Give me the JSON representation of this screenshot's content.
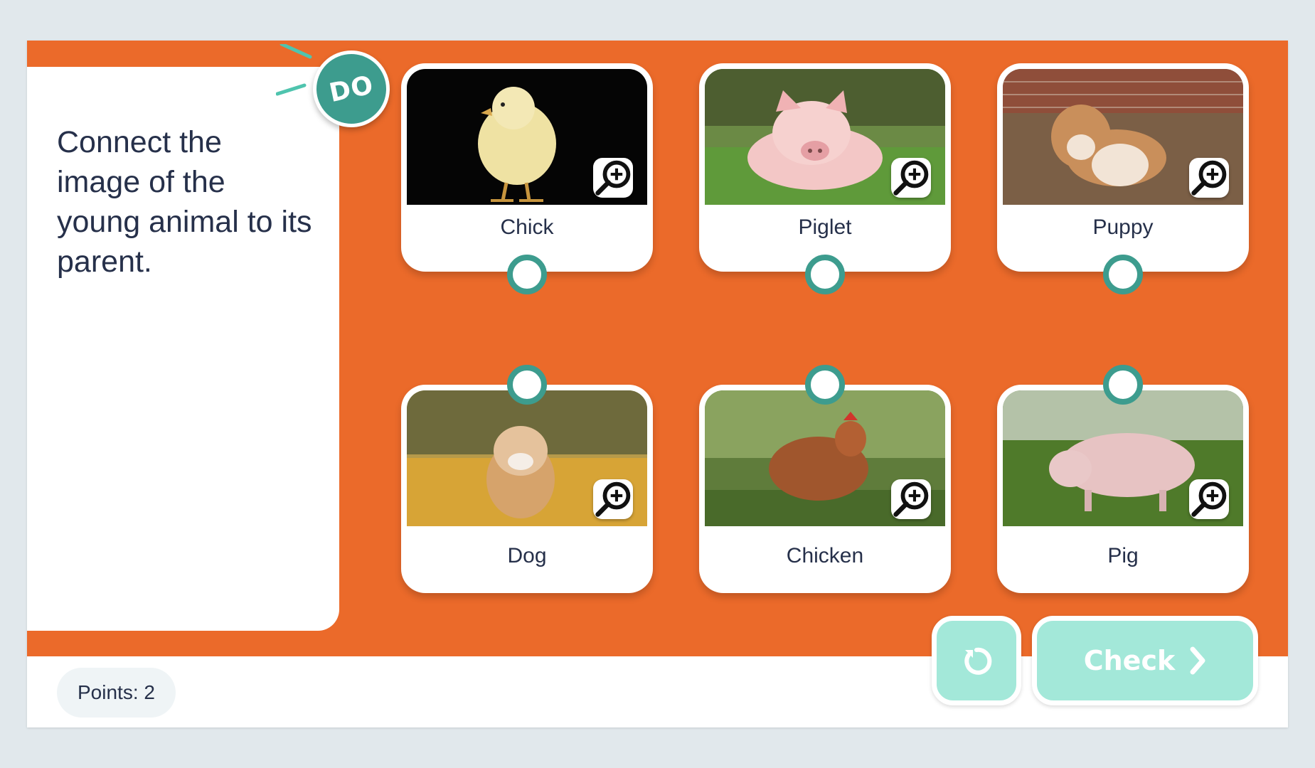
{
  "theme": {
    "stage_color": "#EB6A2A",
    "accent_teal": "#3D9C8E",
    "button_mint": "#A3E8D9",
    "text_dark": "#26304A"
  },
  "instruction": {
    "badge": "DO",
    "text": "Connect the image of the young animal to its parent."
  },
  "cards": [
    {
      "label": "Chick",
      "image": "chick-photo",
      "zoom_icon": "zoom-in-icon"
    },
    {
      "label": "Piglet",
      "image": "piglet-photo",
      "zoom_icon": "zoom-in-icon"
    },
    {
      "label": "Puppy",
      "image": "puppy-photo",
      "zoom_icon": "zoom-in-icon"
    },
    {
      "label": "Dog",
      "image": "dog-photo",
      "zoom_icon": "zoom-in-icon"
    },
    {
      "label": "Chicken",
      "image": "chicken-photo",
      "zoom_icon": "zoom-in-icon"
    },
    {
      "label": "Pig",
      "image": "pig-photo",
      "zoom_icon": "zoom-in-icon"
    }
  ],
  "footer": {
    "points": "Points: 2"
  },
  "actions": {
    "reset_icon": "reset-icon",
    "check_label": "Check",
    "check_icon": "chevron-right-icon"
  }
}
